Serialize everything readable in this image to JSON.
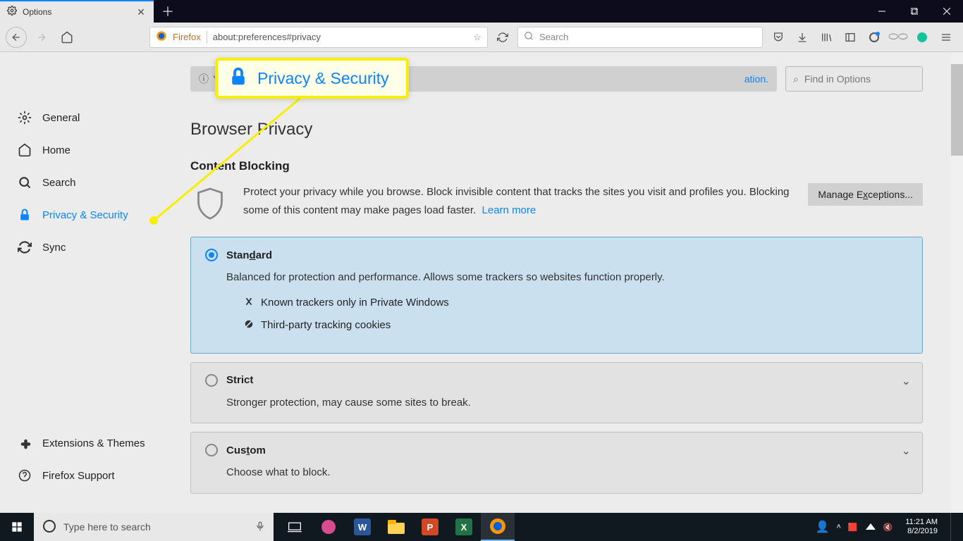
{
  "tab": {
    "title": "Options"
  },
  "url": {
    "brand": "Firefox",
    "address": "about:preferences#privacy"
  },
  "search_placeholder": "Search",
  "sidebar": {
    "items": [
      {
        "label": "General"
      },
      {
        "label": "Home"
      },
      {
        "label": "Search"
      },
      {
        "label": "Privacy & Security"
      },
      {
        "label": "Sync"
      }
    ],
    "bottom": [
      {
        "label": "Extensions & Themes"
      },
      {
        "label": "Firefox Support"
      }
    ]
  },
  "banner": {
    "prefix": "Y",
    "suffix": "ation."
  },
  "find_placeholder": "Find in Options",
  "page": {
    "title": "Browser Privacy",
    "section": "Content Blocking",
    "desc": "Protect your privacy while you browse. Block invisible content that tracks the sites you visit and profiles you. Blocking some of this content may make pages load faster.",
    "learn_more": "Learn more",
    "manage_btn": "Manage Exceptions...",
    "options": {
      "standard": {
        "title_pre": "Stan",
        "title_u": "d",
        "title_post": "ard",
        "desc": "Balanced for protection and performance. Allows some trackers so websites function properly.",
        "items": [
          "Known trackers only in Private Windows",
          "Third-party tracking cookies"
        ]
      },
      "strict": {
        "title": "Strict",
        "desc": "Stronger protection, may cause some sites to break."
      },
      "custom": {
        "title_pre": "Cus",
        "title_u": "t",
        "title_post": "om",
        "desc": "Choose what to block."
      }
    }
  },
  "callout": {
    "label": "Privacy & Security"
  },
  "taskbar": {
    "search_placeholder": "Type here to search",
    "time": "11:21 AM",
    "date": "8/2/2019"
  }
}
